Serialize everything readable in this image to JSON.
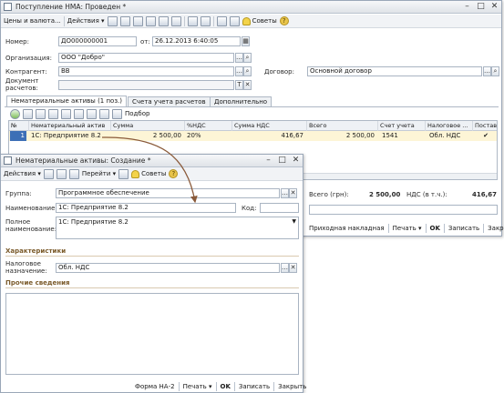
{
  "main_window": {
    "title": "Поступление НМА: Проведен *",
    "controls": [
      "–",
      "□",
      "✕"
    ],
    "toolbar": {
      "prices_label": "Цены и валюта...",
      "actions_label": "Действия ▾",
      "advice_label": "Советы",
      "help_label": "?"
    },
    "fields": {
      "number_label": "Номер:",
      "number_value": "ДО000000001",
      "from_label": "от:",
      "date_value": "26.12.2013  6:40:05",
      "org_label": "Организация:",
      "org_value": "ООО \"Добро\"",
      "contractor_label": "Контрагент:",
      "contractor_value": "ВВ",
      "contract_label": "Договор:",
      "contract_value": "Основной договор",
      "doc_label_1": "Документ",
      "doc_label_2": "расчетов:",
      "doc_value": ""
    },
    "tabs": [
      "Нематериальные активы (1 поз.)",
      "Счета учета расчетов",
      "Дополнительно"
    ],
    "grid_toolbar": {
      "select_label": "Подбор"
    },
    "grid": {
      "columns": [
        "№",
        "Нематериальный актив",
        "Сумма",
        "%НДС",
        "Сумма НДС",
        "Всего",
        "Счет учета",
        "Налоговое ...",
        "Постав"
      ],
      "rows": [
        {
          "num": "1",
          "asset": "1С: Предприятие 8.2",
          "sum": "2 500,00",
          "vat_rate": "20%",
          "vat_sum": "416,67",
          "total": "2 500,00",
          "account": "1541",
          "tax": "Обл. НДС",
          "supplied": "✔"
        }
      ]
    },
    "totals": {
      "total_label": "Всего (грн):",
      "total_value": "2 500,00",
      "vat_label": "НДС (в т.ч.):",
      "vat_value": "416,67"
    },
    "status_bar": {
      "invoice": "Приходная накладная",
      "print": "Печать ▾",
      "ok": "OK",
      "save": "Записать",
      "close": "Закрыть"
    }
  },
  "dialog": {
    "title": "Нематериальные активы: Создание *",
    "controls": [
      "–",
      "□",
      "✕"
    ],
    "toolbar": {
      "actions_label": "Действия ▾",
      "goto_label": "Перейти ▾",
      "advice_label": "Советы",
      "help_label": "?"
    },
    "fields": {
      "group_label": "Группа:",
      "group_value": "Программное обеспечение",
      "name_label": "Наименование:",
      "name_value": "1С: Предприятие 8.2",
      "code_label": "Код:",
      "code_value": "",
      "fullname_label_1": "Полное",
      "fullname_label_2": "наименование:",
      "fullname_value": "1С: Предприятие 8.2"
    },
    "characteristics_head": "Характеристики",
    "tax_label_1": "Налоговое",
    "tax_label_2": "назначение:",
    "tax_value": "Обл. НДС",
    "other_head": "Прочие сведения",
    "status_bar": {
      "form": "Форма НА-2",
      "print": "Печать ▾",
      "ok": "OK",
      "save": "Записать",
      "close": "Закрыть"
    }
  }
}
